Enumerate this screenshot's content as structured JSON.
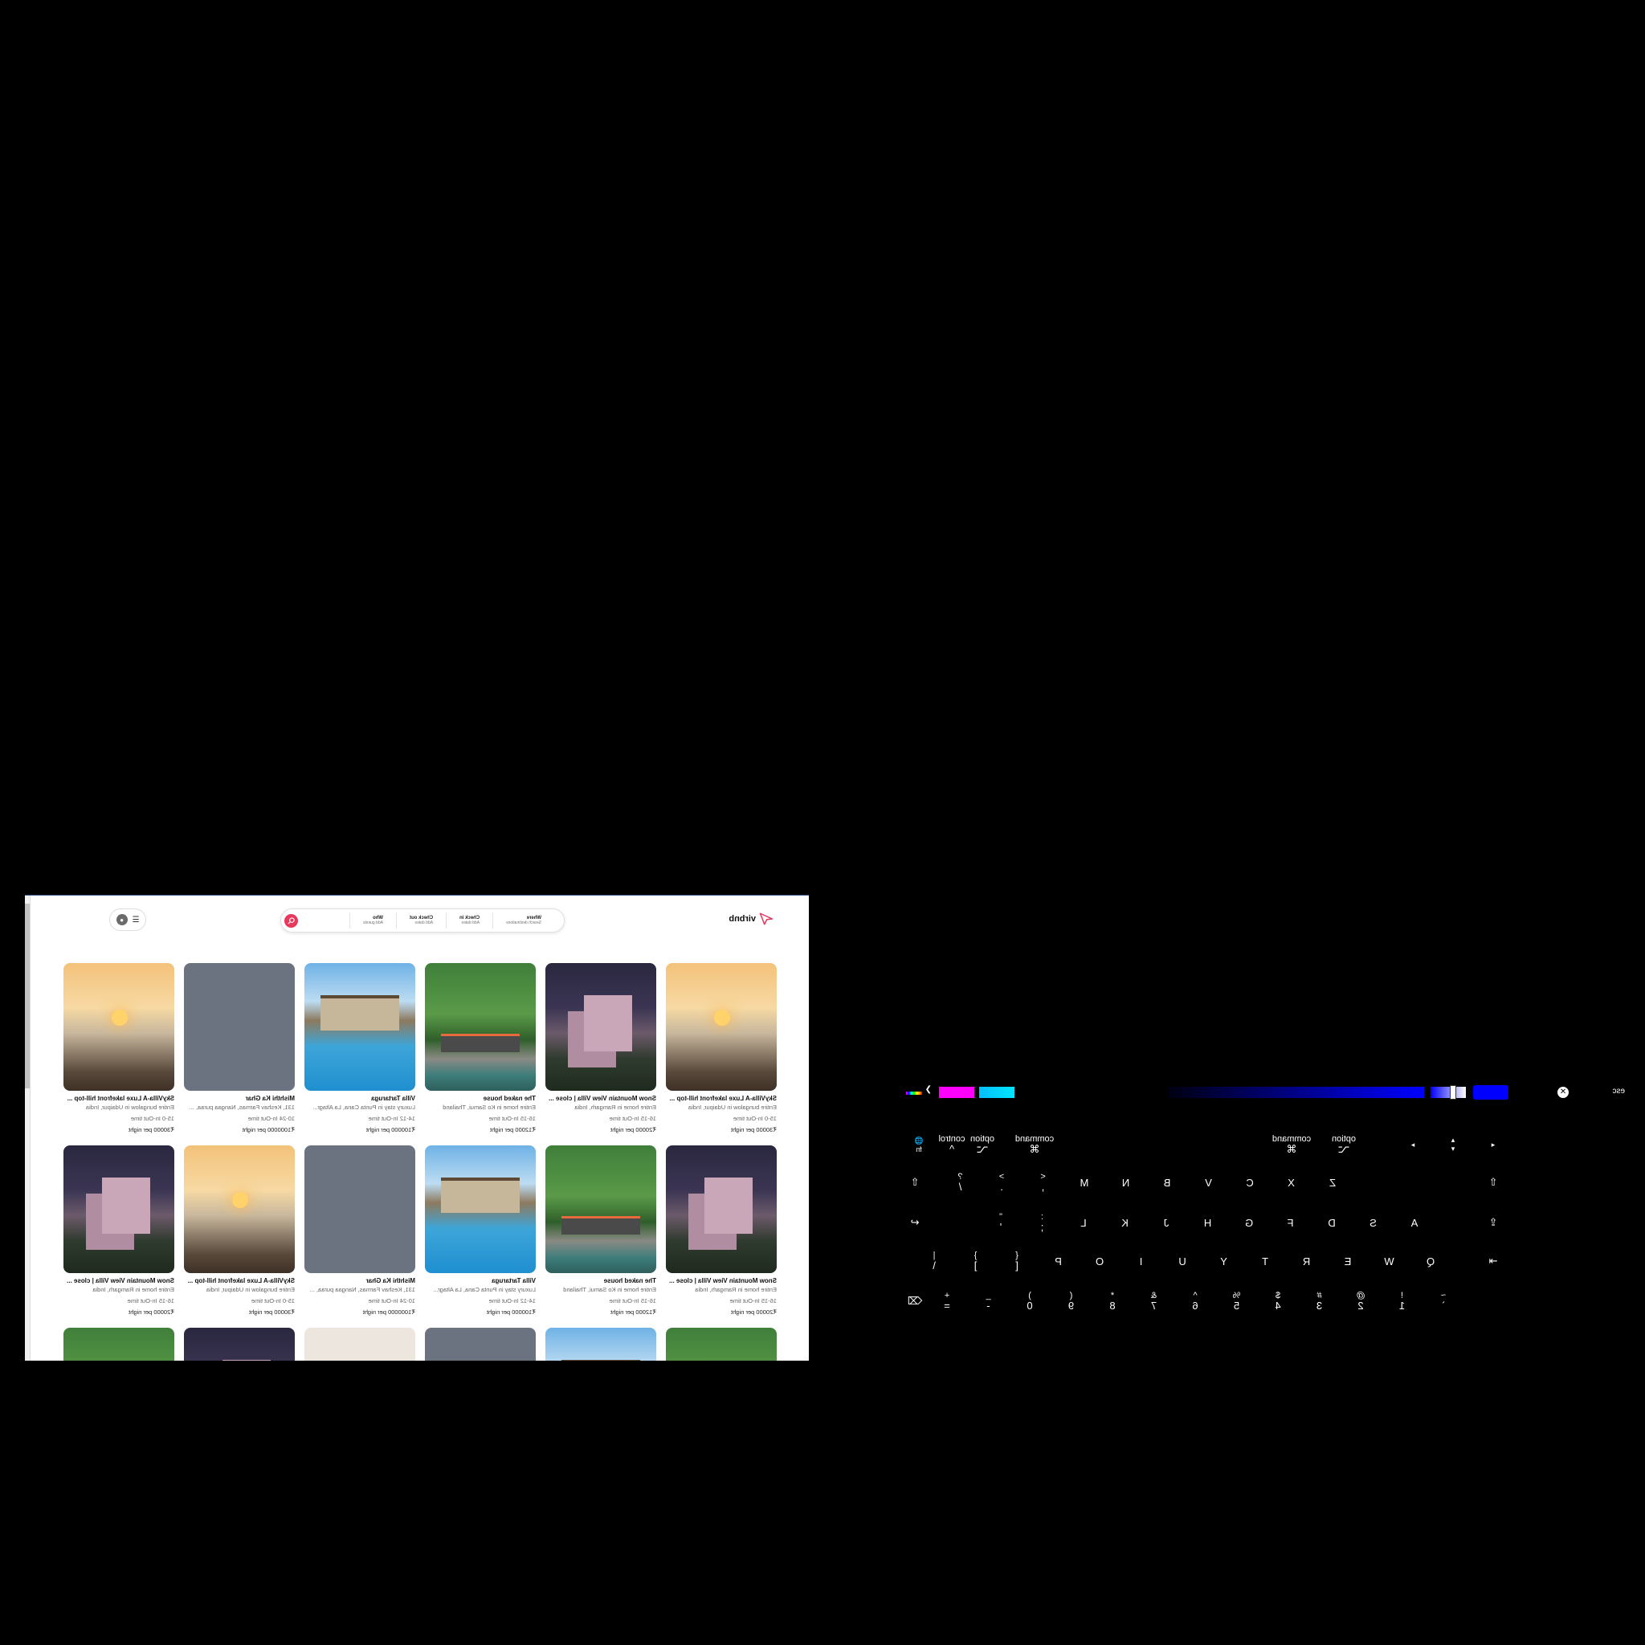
{
  "header": {
    "logo_text": "virbnb",
    "search": {
      "where_label": "Where",
      "where_sub": "Search destinations",
      "checkin_label": "Check in",
      "checkin_sub": "Add dates",
      "checkout_label": "Check out",
      "checkout_sub": "Add dates",
      "who_label": "Who",
      "who_sub": "Add guests"
    }
  },
  "listings": [
    {
      "title": "SkyVilla-A Luxe lakefront hill-top ...",
      "desc": "Entire bungalow in Udaipur, India",
      "time": "15-0 In-Out time",
      "price": "₹30000 per night",
      "img": "sunset"
    },
    {
      "title": "Snow Mountain View Villa | close ...",
      "desc": "Entire home in Ramgarh, India",
      "time": "16-15 In-Out time",
      "price": "₹20000 per night",
      "img": "villa"
    },
    {
      "title": "The naked house",
      "desc": "Entire home in Ko Samui, Thailand",
      "time": "16-15 In-Out time",
      "price": "₹12000 per night",
      "img": "naked"
    },
    {
      "title": "Villa Tartaruga",
      "desc": "Luxury stay in Punta Cana, La Altagr...",
      "time": "14-12 In-Out time",
      "price": "₹100000 per night",
      "img": "pool"
    },
    {
      "title": "Mishthi Ka Ghar",
      "desc": "131, Keshav Farmas, Nangaa puraa, ...",
      "time": "10-24 In-Out time",
      "price": "₹1000000 per night",
      "img": "grey"
    },
    {
      "title": "SkyVilla-A Luxe lakefront hill-top ...",
      "desc": "Entire bungalow in Udaipur, India",
      "time": "15-0 In-Out time",
      "price": "₹30000 per night",
      "img": "sunset"
    },
    {
      "title": "Snow Mountain View Villa | close ...",
      "desc": "Entire home in Ramgarh, India",
      "time": "16-15 In-Out time",
      "price": "₹20000 per night",
      "img": "villa"
    },
    {
      "title": "The naked house",
      "desc": "Entire home in Ko Samui, Thailand",
      "time": "16-15 In-Out time",
      "price": "₹12000 per night",
      "img": "naked"
    },
    {
      "title": "Villa Tartaruga",
      "desc": "Luxury stay in Punta Cana, La Altagr...",
      "time": "14-12 In-Out time",
      "price": "₹100000 per night",
      "img": "pool"
    },
    {
      "title": "Mishthi Ka Ghar",
      "desc": "131, Keshav Farmas, Nangaa puraa, ...",
      "time": "10-24 In-Out time",
      "price": "₹1000000 per night",
      "img": "grey"
    },
    {
      "title": "SkyVilla-A Luxe lakefront hill-top ...",
      "desc": "Entire bungalow in Udaipur, India",
      "time": "15-0 In-Out time",
      "price": "₹30000 per night",
      "img": "sunset"
    },
    {
      "title": "Snow Mountain View Villa | close ...",
      "desc": "Entire home in Ramgarh, India",
      "time": "16-15 In-Out time",
      "price": "₹20000 per night",
      "img": "villa"
    }
  ],
  "partial_row_images": [
    "naked",
    "pool",
    "grey",
    "beige",
    "villa",
    "naked"
  ],
  "keyboard": {
    "row_numbers": [
      {
        "s": "~",
        "m": "`"
      },
      {
        "s": "!",
        "m": "1"
      },
      {
        "s": "@",
        "m": "2"
      },
      {
        "s": "#",
        "m": "3"
      },
      {
        "s": "$",
        "m": "4"
      },
      {
        "s": "%",
        "m": "5"
      },
      {
        "s": "^",
        "m": "6"
      },
      {
        "s": "&",
        "m": "7"
      },
      {
        "s": "*",
        "m": "8"
      },
      {
        "s": "(",
        "m": "9"
      },
      {
        "s": ")",
        "m": "0"
      },
      {
        "s": "_",
        "m": "-"
      },
      {
        "s": "+",
        "m": "="
      }
    ],
    "delete_icon": "delete-icon",
    "tab_icon": "tab-icon",
    "row_qwerty": [
      "Q",
      "W",
      "E",
      "R",
      "T",
      "Y",
      "U",
      "I",
      "O",
      "P"
    ],
    "row_qwerty_brackets": [
      {
        "s": "{",
        "m": "["
      },
      {
        "s": "}",
        "m": "]"
      },
      {
        "s": "|",
        "m": "\\"
      }
    ],
    "caps_icon": "caps-lock-icon",
    "row_home": [
      "A",
      "S",
      "D",
      "F",
      "G",
      "H",
      "J",
      "K",
      "L"
    ],
    "row_home_punct": [
      {
        "s": ":",
        "m": ";"
      },
      {
        "s": "\"",
        "m": "'"
      }
    ],
    "return_icon": "return-icon",
    "shift_icon": "shift-icon",
    "row_bottom": [
      "Z",
      "X",
      "C",
      "V",
      "B",
      "N",
      "M"
    ],
    "row_bottom_punct": [
      {
        "s": "<",
        "m": ","
      },
      {
        "s": ">",
        "m": "."
      },
      {
        "s": "?",
        "m": "/"
      }
    ],
    "mods": {
      "fn": "fn",
      "globe_icon": "globe-icon",
      "control": "control",
      "control_sym": "^",
      "option": "option",
      "option_sym": "⌥",
      "command": "command",
      "command_sym": "⌘",
      "arrow_left": "◂",
      "arrow_up": "▴",
      "arrow_down": "▾",
      "arrow_right": "▸"
    },
    "esc": "esc",
    "colors": {
      "picked": "#0000ff",
      "gradient_start": "#000010",
      "gradient_end": "#0000ff",
      "swatch_cyan": "#00e5ff",
      "swatch_magenta": "#ff00ff"
    }
  }
}
